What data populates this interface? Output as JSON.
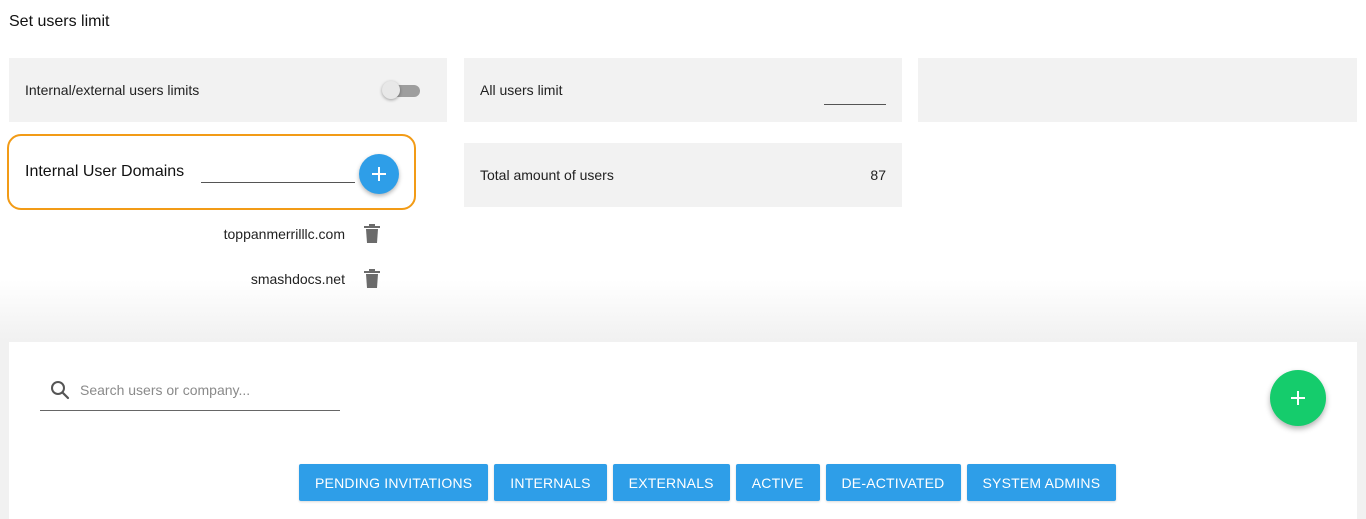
{
  "page": {
    "title": "Set users limit"
  },
  "limits": {
    "internal_external_label": "Internal/external users limits",
    "internal_external_enabled": false,
    "all_users_label": "All users limit",
    "all_users_value": "",
    "total_label": "Total amount of users",
    "total_value": "87"
  },
  "domains": {
    "label": "Internal User Domains",
    "input_value": "",
    "items": [
      "toppanmerrilllc.com",
      "smashdocs.net"
    ]
  },
  "users": {
    "search_placeholder": "Search users or company...",
    "filters": [
      "PENDING INVITATIONS",
      "INTERNALS",
      "EXTERNALS",
      "ACTIVE",
      "DE-ACTIVATED",
      "SYSTEM ADMINS"
    ]
  },
  "colors": {
    "accent": "#2e9ee8",
    "add_user": "#15cc6c",
    "highlight": "#f29b16",
    "card_bg": "#f2f2f2"
  },
  "icons": {
    "add_domain": "plus-icon",
    "add_user": "plus-icon",
    "search": "search-icon",
    "delete": "trash-icon"
  }
}
